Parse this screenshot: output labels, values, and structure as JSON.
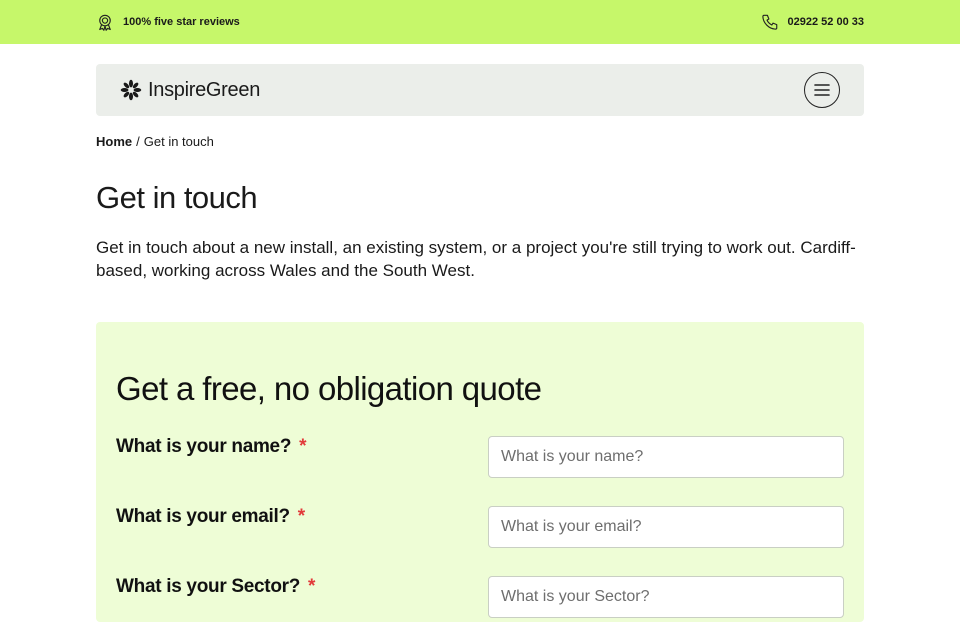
{
  "topbar": {
    "reviews_text": "100% five star reviews",
    "reviews_icon": "award-icon",
    "phone_text": "02922 52 00 33",
    "phone_icon": "phone-icon",
    "background": "#c6f76a"
  },
  "navbar": {
    "logo_text": "InspireGreen",
    "logo_icon": "asterisk-flower-icon",
    "menu_icon": "hamburger-menu-icon"
  },
  "breadcrumb": {
    "home": "Home",
    "separator": "/",
    "current": "Get in touch"
  },
  "page": {
    "title": "Get in touch",
    "intro": "Get in touch about a new install, an existing system, or a project you're still trying to work out. Cardiff-based, working across Wales and the South West."
  },
  "quote_form": {
    "title": "Get a free, no obligation quote",
    "background": "#eefdd6",
    "required_marker": "*",
    "fields": [
      {
        "label": "What is your name?",
        "placeholder": "What is your name?",
        "value": ""
      },
      {
        "label": "What is your email?",
        "placeholder": "What is your email?",
        "value": ""
      },
      {
        "label": "What is your Sector?",
        "placeholder": "What is your Sector?",
        "value": ""
      }
    ]
  }
}
